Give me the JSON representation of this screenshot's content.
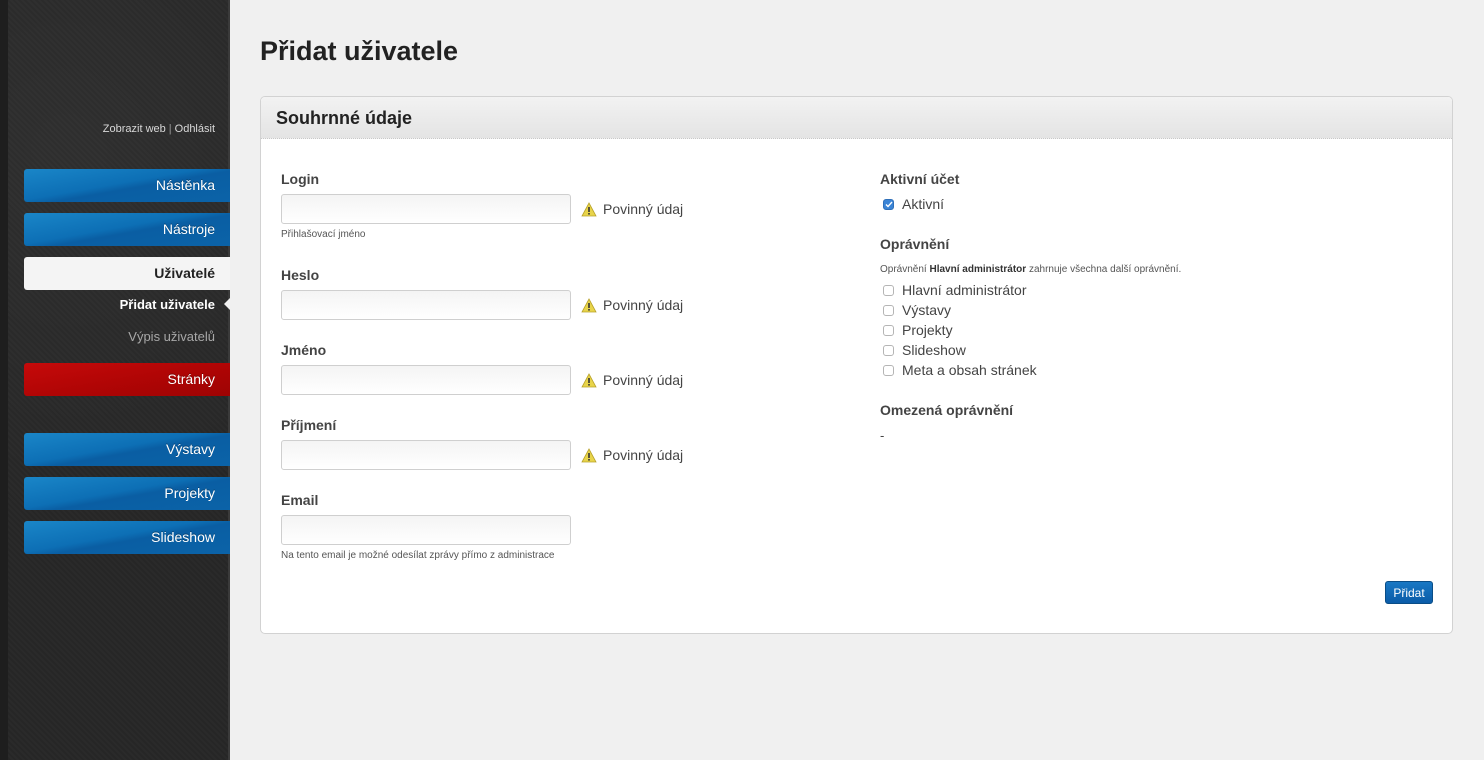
{
  "sidebar": {
    "top_links": {
      "view_site": "Zobrazit web",
      "separator": "|",
      "logout": "Odhlásit"
    },
    "nav": [
      {
        "label": "Nástěnka",
        "style": "blue"
      },
      {
        "label": "Nástroje",
        "style": "blue"
      },
      {
        "label": "Uživatelé",
        "style": "active"
      },
      {
        "label": "Stránky",
        "style": "red"
      },
      {
        "label": "Výstavy",
        "style": "blue"
      },
      {
        "label": "Projekty",
        "style": "blue"
      },
      {
        "label": "Slideshow",
        "style": "blue"
      }
    ],
    "sub_items": [
      {
        "label": "Přidat uživatele",
        "active": true
      },
      {
        "label": "Výpis uživatelů",
        "active": false
      }
    ]
  },
  "page": {
    "title": "Přidat uživatele"
  },
  "panel": {
    "title": "Souhrnné údaje",
    "fields": {
      "login": {
        "label": "Login",
        "value": "",
        "required_text": "Povinný údaj",
        "hint": "Přihlašovací jméno"
      },
      "password": {
        "label": "Heslo",
        "value": "",
        "required_text": "Povinný údaj"
      },
      "first_name": {
        "label": "Jméno",
        "value": "",
        "required_text": "Povinný údaj"
      },
      "last_name": {
        "label": "Příjmení",
        "value": "",
        "required_text": "Povinný údaj"
      },
      "email": {
        "label": "Email",
        "value": "",
        "hint": "Na tento email je možné odesílat zprávy přímo z administrace"
      }
    },
    "active_account": {
      "label": "Aktivní účet",
      "checkbox": {
        "label": "Aktivní",
        "checked": true
      }
    },
    "permissions": {
      "label": "Oprávnění",
      "note_prefix": "Oprávnění ",
      "note_bold": "Hlavní administrátor",
      "note_suffix": " zahrnuje všechna další oprávnění.",
      "items": [
        {
          "label": "Hlavní administrátor",
          "checked": false
        },
        {
          "label": "Výstavy",
          "checked": false
        },
        {
          "label": "Projekty",
          "checked": false
        },
        {
          "label": "Slideshow",
          "checked": false
        },
        {
          "label": "Meta a obsah stránek",
          "checked": false
        }
      ]
    },
    "limited_permissions": {
      "label": "Omezená oprávnění",
      "value": "-"
    },
    "submit_label": "Přidat"
  },
  "colors": {
    "nav_blue": "#0d6fb5",
    "nav_red": "#b10505",
    "checkbox_checked": "#3a84d6",
    "submit_button": "#0b5ca8"
  }
}
